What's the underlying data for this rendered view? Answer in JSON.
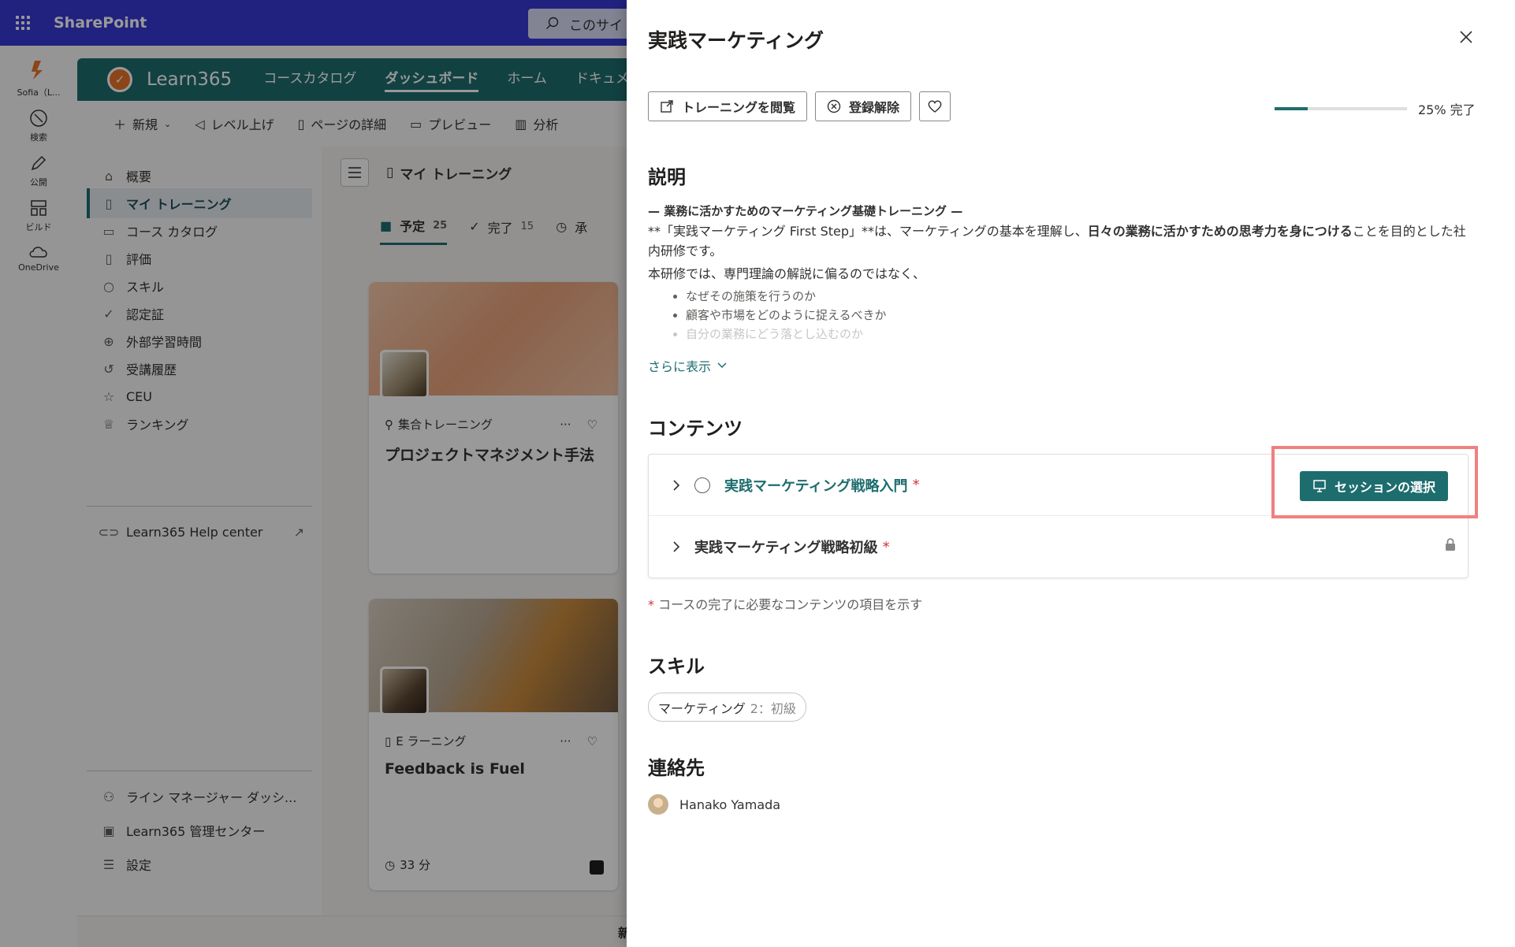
{
  "sharepoint": {
    "title": "SharePoint",
    "search_placeholder": "このサイ"
  },
  "app_rail": [
    {
      "label": "Sofia（L...",
      "icon": "user-logo-icon"
    },
    {
      "label": "検索",
      "icon": "search-icon"
    },
    {
      "label": "公開",
      "icon": "pen-icon"
    },
    {
      "label": "ビルド",
      "icon": "build-icon"
    },
    {
      "label": "OneDrive",
      "icon": "cloud-icon"
    }
  ],
  "learn365": {
    "name": "Learn365",
    "nav": [
      "コースカタログ",
      "ダッシュボード",
      "ホーム",
      "ドキュメ"
    ],
    "active_nav": "ダッシュボード"
  },
  "command_bar": {
    "new": "新規",
    "level_up": "レベル上げ",
    "page_details": "ページの詳細",
    "preview": "プレビュー",
    "analytics": "分析"
  },
  "left_nav": {
    "items": [
      "概要",
      "マイ トレーニング",
      "コース カタログ",
      "評価",
      "スキル",
      "認定証",
      "外部学習時間",
      "受講履歴",
      "CEU",
      "ランキング"
    ],
    "help": "Learn365 Help center",
    "bottom": [
      "ライン マネージャー ダッシ...",
      "Learn365 管理センター",
      "設定"
    ]
  },
  "main": {
    "title": "マイ トレーニング",
    "tabs": [
      {
        "label": "予定",
        "count": "25"
      },
      {
        "label": "完了",
        "count": "15"
      },
      {
        "label": "承",
        "count": ""
      }
    ],
    "cards": [
      {
        "type": "集合トレーニング",
        "title": "プロジェクトマネジメント手法",
        "duration": ""
      },
      {
        "type": "E ラーニング",
        "title": "Feedback is Fuel",
        "duration": "33 分"
      }
    ],
    "bottom_text": "新しいテ"
  },
  "panel": {
    "title": "実践マーケティング",
    "actions": {
      "browse": "トレーニングを閲覧",
      "unregister": "登録解除"
    },
    "progress": {
      "value": 0.25,
      "text": "25% 完了"
    },
    "description": {
      "heading": "説明",
      "subtitle": "— 業務に活かすためのマーケティング基礎トレーニング —",
      "p1_a": "**「実践マーケティング First Step」**は、マーケティングの基本を理解し、",
      "p1_b": "日々の業務に活かすための思考力を身につける",
      "p1_c": "ことを目的とした社内研修です。",
      "p2": "本研修では、専門理論の解説に偏るのではなく、",
      "bullets": [
        "なぜその施策を行うのか",
        "顧客や市場をどのように捉えるべきか",
        "自分の業務にどう落とし込むのか"
      ],
      "show_more": "さらに表示"
    },
    "contents": {
      "heading": "コンテンツ",
      "items": [
        {
          "title": "実践マーケティング戦略入門",
          "required": "*",
          "action": "セッションの選択"
        },
        {
          "title": "実践マーケティング戦略初級",
          "required": "*"
        }
      ],
      "note_star": "*",
      "note": "コースの完了に必要なコンテンツの項目を示す"
    },
    "skills": {
      "heading": "スキル",
      "chip_name": "マーケティング",
      "chip_level": "2：初級"
    },
    "contact": {
      "heading": "連絡先",
      "name": "Hanako Yamada"
    }
  },
  "colors": {
    "suite_bar": "#3737d6",
    "learn365_teal": "#1e6d6e",
    "highlight": "#f08080",
    "required": "#d13438"
  }
}
